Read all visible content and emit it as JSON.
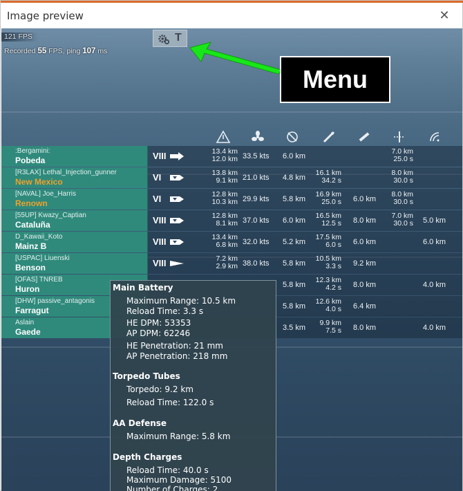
{
  "window": {
    "title": "Image preview",
    "close_glyph": "✕",
    "accent_color": "#d96a2b"
  },
  "hud": {
    "fps_value": "121",
    "fps_label": "FPS",
    "recorded_label": "Recorded",
    "recorded_fps": "55",
    "fps_unit": "FPS",
    "ping_label": "ping",
    "ping_value": "107",
    "ping_unit": "ms",
    "menu_icons": [
      "gear-icon",
      "t-icon"
    ],
    "menu_t_glyph": "T"
  },
  "annotation": {
    "label": "Menu",
    "arrow_color": "#19e619"
  },
  "columns": [
    "warning-range-icon",
    "speed-propeller-icon",
    "concealment-icon",
    "torpedo-icon",
    "secondary-battery-icon",
    "aa-icon",
    "radar-icon"
  ],
  "rows": [
    {
      "player": ":Bergamini:",
      "ship": "Pobeda",
      "ship_color": "white",
      "tier": "VIII",
      "cls": "cruiser-icon",
      "range1": "13.4 km",
      "range2": "12.0 km",
      "speed": "33.5 kts",
      "conceal": "6.0 km",
      "torp1": "",
      "torp2": "",
      "sec": "",
      "aa1": "7.0 km",
      "aa2": "25.0 s",
      "radar": ""
    },
    {
      "player": "[R3LAX] Lethal_Injection_gunner",
      "ship": "New Mexico",
      "ship_color": "orange",
      "tier": "VI",
      "cls": "battleship-icon",
      "range1": "13.8 km",
      "range2": "9.1 km",
      "speed": "21.0 kts",
      "conceal": "4.8 km",
      "torp1": "16.1 km",
      "torp2": "34.2 s",
      "sec": "",
      "aa1": "8.0 km",
      "aa2": "30.0 s",
      "radar": ""
    },
    {
      "player": "[NAVAL] Joe_Harris",
      "ship": "Renown",
      "ship_color": "orange",
      "tier": "VI",
      "cls": "battleship-icon",
      "range1": "12.8 km",
      "range2": "10.3 km",
      "speed": "29.9 kts",
      "conceal": "5.8 km",
      "torp1": "16.9 km",
      "torp2": "25.0 s",
      "sec": "6.0 km",
      "aa1": "8.0 km",
      "aa2": "30.0 s",
      "radar": ""
    },
    {
      "player": "[55UP] Kwazy_Captian",
      "ship": "Cataluña",
      "ship_color": "white",
      "tier": "VIII",
      "cls": "battleship-icon",
      "range1": "12.8 km",
      "range2": "8.1 km",
      "speed": "37.0 kts",
      "conceal": "6.0 km",
      "torp1": "16.5 km",
      "torp2": "12.5 s",
      "sec": "8.0 km",
      "aa1": "7.0 km",
      "aa2": "30.0 s",
      "radar": "5.0 km"
    },
    {
      "player": "D_Kawaii_Koto",
      "ship": "Mainz B",
      "ship_color": "white",
      "tier": "VIII",
      "cls": "battleship-icon",
      "range1": "13.4 km",
      "range2": "6.8 km",
      "speed": "32.0 kts",
      "conceal": "5.2 km",
      "torp1": "17.5 km",
      "torp2": "6.0 s",
      "sec": "6.0 km",
      "aa1": "",
      "aa2": "",
      "radar": "6.0 km"
    },
    {
      "player": "[USPAC] Liuenski",
      "ship": "Benson",
      "ship_color": "white",
      "tier": "VIII",
      "cls": "destroyer-icon",
      "range1": "7.2 km",
      "range2": "2.9 km",
      "speed": "38.0 kts",
      "conceal": "5.8 km",
      "torp1": "10.5 km",
      "torp2": "3.3 s",
      "sec": "9.2 km",
      "aa1": "",
      "aa2": "",
      "radar": ""
    },
    {
      "player": "[OFAS] TNREB",
      "ship": "Huron",
      "ship_color": "white",
      "tier": "",
      "cls": "",
      "range1": "",
      "range2": "",
      "speed": "",
      "conceal": "5.8 km",
      "torp1": "12.3 km",
      "torp2": "4.2 s",
      "sec": "8.0 km",
      "aa1": "",
      "aa2": "",
      "radar": "4.0 km"
    },
    {
      "player": "[DHW] passive_antagonis",
      "ship": "Farragut",
      "ship_color": "white",
      "tier": "",
      "cls": "",
      "range1": "",
      "range2": "",
      "speed": "",
      "conceal": "5.8 km",
      "torp1": "12.6 km",
      "torp2": "4.0 s",
      "sec": "6.4 km",
      "aa1": "",
      "aa2": "",
      "radar": ""
    },
    {
      "player": "Aslain",
      "ship": "Gaede",
      "ship_color": "white",
      "tier": "",
      "cls": "",
      "range1": "",
      "range2": "",
      "speed": "",
      "conceal": "3.5 km",
      "torp1": "9.9 km",
      "torp2": "7.5 s",
      "sec": "8.0 km",
      "aa1": "",
      "aa2": "",
      "radar": "4.0 km"
    }
  ],
  "tooltip": {
    "main_battery_title": "Main Battery",
    "max_range_label": "Maximum Range:",
    "max_range_value": "10.5",
    "max_range_unit": "km",
    "reload_label": "Reload Time:",
    "reload_value": "3.3",
    "reload_unit": "s",
    "he_dpm_label": "HE DPM:",
    "he_dpm_value": "53353",
    "ap_dpm_label": "AP DPM:",
    "ap_dpm_value": "62246",
    "he_pen_label": "HE Penetration:",
    "he_pen_value": "21",
    "he_pen_unit": "mm",
    "ap_pen_label": "AP Penetration:",
    "ap_pen_value": "218",
    "ap_pen_unit": "mm",
    "torpedo_title": "Torpedo Tubes",
    "torpedo_label": "Torpedo:",
    "torpedo_value": "9.2",
    "torpedo_unit": "km",
    "torp_reload_label": "Reload Time:",
    "torp_reload_value": "122.0",
    "torp_reload_unit": "s",
    "aa_title": "AA Defense",
    "aa_range_label": "Maximum Range:",
    "aa_range_value": "5.8",
    "aa_range_unit": "km",
    "depth_title": "Depth Charges",
    "dc_reload_label": "Reload Time:",
    "dc_reload_value": "40.0",
    "dc_reload_unit": "s",
    "dc_damage_label": "Maximum Damage:",
    "dc_damage_value": "5100",
    "dc_charges_label": "Number of Charges:",
    "dc_charges_value": "2"
  }
}
